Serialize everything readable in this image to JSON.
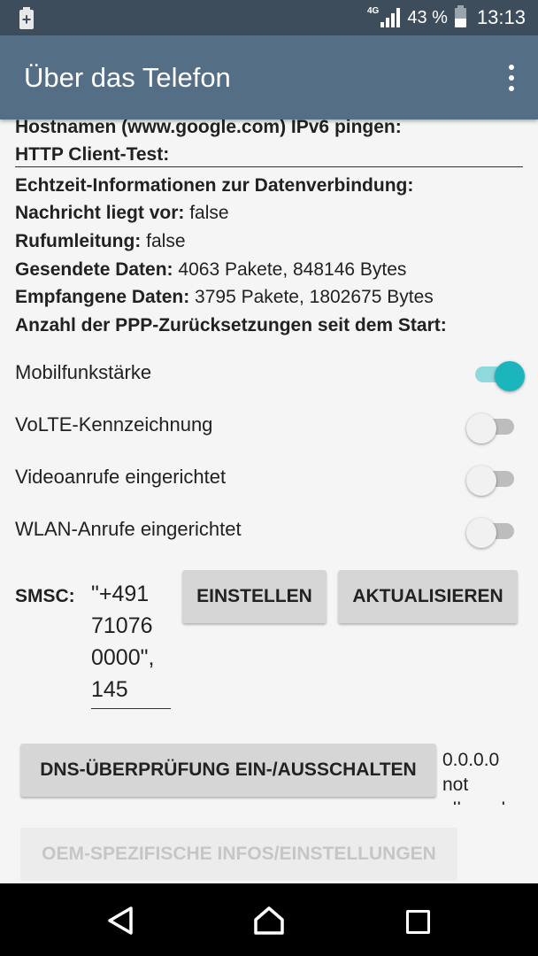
{
  "status_bar": {
    "left_icon": "battery-saver-icon",
    "network": "4G",
    "battery": "43 %",
    "time": "13:13"
  },
  "app_bar": {
    "title": "Über das Telefon",
    "menu_icon": "overflow-menu-icon"
  },
  "info": {
    "ping_ipv6_label": "Hostnamen (www.google.com) IPv6 pingen:",
    "http_test_label": "HTTP Client-Test:",
    "realtime_label": "Echtzeit-Informationen zur Datenverbindung:",
    "message_waiting_label": "Nachricht liegt vor:",
    "message_waiting_value": "false",
    "call_forward_label": "Rufumleitung:",
    "call_forward_value": "false",
    "sent_label": "Gesendete Daten:",
    "sent_value": "4063 Pakete, 848146 Bytes",
    "received_label": "Empfangene Daten:",
    "received_value": "3795 Pakete, 1802675 Bytes",
    "ppp_label": "Anzahl der PPP-Zurücksetzungen seit dem Start:"
  },
  "toggles": [
    {
      "label": "Mobilfunkstärke",
      "on": true
    },
    {
      "label": "VoLTE-Kennzeichnung",
      "on": false
    },
    {
      "label": "Videoanrufe eingerichtet",
      "on": false
    },
    {
      "label": "WLAN-Anrufe eingerichtet",
      "on": false
    }
  ],
  "smsc": {
    "label": "SMSC:",
    "value_lines": [
      "\"+491",
      "71076",
      "0000\",",
      "145"
    ],
    "set_button": "EINSTELLEN",
    "refresh_button": "AKTUALISIEREN"
  },
  "dns": {
    "button": "DNS-ÜBERPRÜFUNG EIN-/AUSSCHALTEN",
    "status_lines": [
      "0.0.0.0",
      "not",
      "allowed"
    ]
  },
  "oem_button": "OEM-SPEZIFISCHE INFOS/EINSTELLUNGEN"
}
